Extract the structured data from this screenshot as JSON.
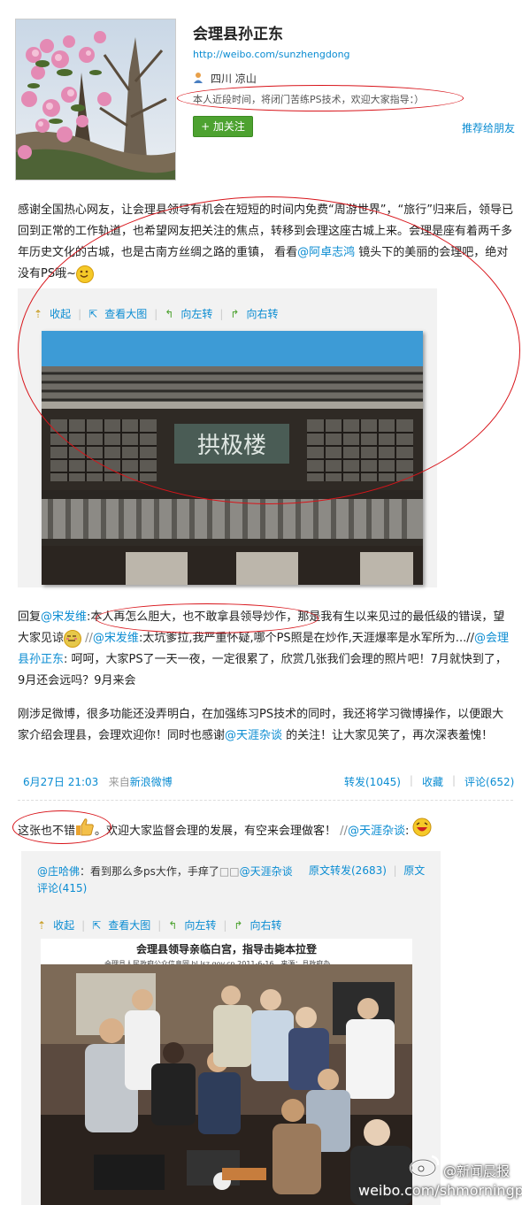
{
  "profile": {
    "name": "会理县孙正东",
    "url": "http://weibo.com/sunzhengdong",
    "location": "四川 凉山",
    "bio": "本人近段时间，将闭门苦练PS技术，欢迎大家指导：）",
    "follow_label": "+ 加关注",
    "recommend_label": "推荐给朋友"
  },
  "post": {
    "text_a": "感谢全国热心网友，让会理县领导有机会在短短的时间内免费“周游世界”，“旅行”归来后，领导已回到正常的工作轨道，也希望网友把关注的焦点，转移到会理这座古城上来。会理是座有着两千多年历史文化的古城，也是古南方丝绸之路的重镇，  看看",
    "mention_a": "@阿卓志鸿",
    "text_b": "镜头下的美丽的会理吧，绝对没有PS哦~",
    "tools": [
      "收起",
      "查看大图",
      "向左转",
      "向右转"
    ],
    "image_sign": "拱极楼"
  },
  "reply": {
    "prefix": "回复",
    "mention1": "@宋发维",
    "text1": ":本人再怎么胆大，也不敢拿县领导炒作，那是我有生以来见过的最低级的错误，望大家见谅",
    "sep1": "//",
    "mention2": "@宋发维",
    "text2": ":太坑爹拉,我严重怀疑,哪个PS照是在炒作,天涯爆率是水军所为...//",
    "mention3": "@会理县孙正东",
    "text3": ": 呵呵，大家PS了一天一夜，一定很累了，欣赏几张我们会理的照片吧！7月就快到了，9月还会远吗？9月来会"
  },
  "para2": {
    "text1": "刚涉足微博，很多功能还没弄明白，在加强练习PS技术的同时，我还将学习微博操作，以便跟大家介绍会理县，会理欢迎你！同时也感谢",
    "mention": "@天涯杂谈",
    "text2": "的关注！让大家见笑了，再次深表羞愧！"
  },
  "meta": {
    "time": "6月27日 21:03",
    "source_prefix": "来自",
    "source": "新浪微博",
    "repost": "转发(1045)",
    "fav": "收藏",
    "comment": "评论(652)"
  },
  "post2": {
    "text1": "这张也不错",
    "text2": "。欢迎大家监督会理的发展，有空来会理做客！",
    "sep": "//",
    "mention": "@天涯杂谈",
    "colon": ":"
  },
  "quote": {
    "author": "@庄哈佛",
    "text": "：看到那么多ps大作，手痒了",
    "mention": "@天涯杂谈",
    "repost": "原文转发(2683)",
    "comment_a": "原文",
    "comment_b": "评论(415)",
    "tools": [
      "收起",
      "查看大图",
      "向左转",
      "向右转"
    ],
    "news_title": "会理县领导亲临白宫，指导击毙本拉登",
    "news_sub1": "会理县人民政府公众信息网  hl.lsz.gov.cn   2011-6-16",
    "news_sub2": "来源：县政府办"
  },
  "watermark": {
    "brand": "@新闻晨报",
    "url": "weibo.com/shmorningpost"
  }
}
